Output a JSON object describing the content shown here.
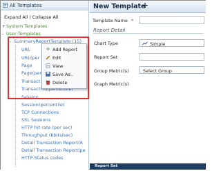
{
  "left_panel": {
    "title": "All Templates",
    "expand_collapse": "Expand All | Collapse All",
    "tree": {
      "system_templates": "System Templates",
      "user_templates": "User Templates",
      "summary_report": "SummaryReportTemplate (15)",
      "children_hidden": [
        "URL",
        "URL(per",
        "Page",
        "Page(per",
        "Transact",
        "Transaction(percentile)"
      ],
      "children": [
        "Session",
        "Session(percentile)",
        "TCP Connections",
        "SSL Sessions",
        "HTTP hit rate (per sec)",
        "Throughput (Kbits/sec)",
        "Detail Transaction Report(A",
        "Detail Transaction Report(pe",
        "HTTP Status codes"
      ]
    },
    "context_menu": [
      {
        "label": "Add Report",
        "icon": "plus-icon"
      },
      {
        "label": "Edit",
        "icon": "pencil-icon"
      },
      {
        "label": "View",
        "icon": "document-icon"
      },
      {
        "label": "Save As..",
        "icon": "save-icon"
      },
      {
        "label": "Delete",
        "icon": "trash-icon"
      }
    ]
  },
  "right_panel": {
    "title": "New Template",
    "plus": "+",
    "template_name_label": "Template Name",
    "report_detail_section": "Report Detail",
    "chart_type_label": "Chart Type",
    "chart_type_value": "Simple",
    "report_set_label": "Report Set",
    "group_metrics_label": "Group Metric(s)",
    "group_metrics_value": "Select Group",
    "graph_metrics_label": "Graph Metric(s)",
    "report_set_bar": "Report Set"
  },
  "colors": {
    "highlight": "#e52d2d",
    "tree_green": "#3f8b2a",
    "tree_blue": "#3a6fb7",
    "bottom_bar": "#1d3d63"
  }
}
